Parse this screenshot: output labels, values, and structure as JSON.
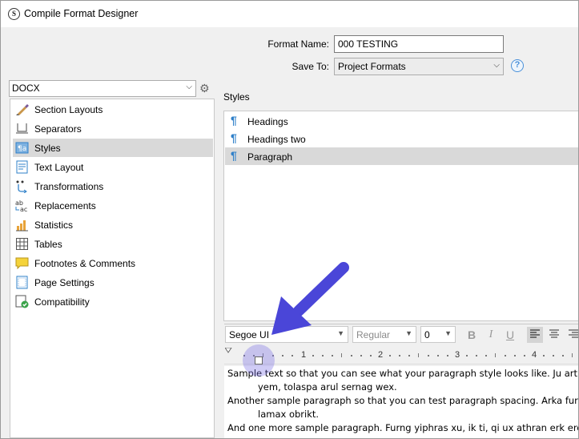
{
  "window": {
    "title": "Compile Format Designer"
  },
  "format": {
    "name_label": "Format Name:",
    "name_value": "000 TESTING",
    "save_label": "Save To:",
    "save_value": "Project Formats",
    "help": "?"
  },
  "sidebar": {
    "format_type": "DOCX",
    "items": [
      {
        "label": "Section Layouts",
        "icon": "section-layouts-icon"
      },
      {
        "label": "Separators",
        "icon": "separators-icon"
      },
      {
        "label": "Styles",
        "icon": "styles-icon",
        "selected": true
      },
      {
        "label": "Text Layout",
        "icon": "text-layout-icon"
      },
      {
        "label": "Transformations",
        "icon": "transformations-icon"
      },
      {
        "label": "Replacements",
        "icon": "replacements-icon"
      },
      {
        "label": "Statistics",
        "icon": "statistics-icon"
      },
      {
        "label": "Tables",
        "icon": "tables-icon"
      },
      {
        "label": "Footnotes & Comments",
        "icon": "footnotes-icon"
      },
      {
        "label": "Page Settings",
        "icon": "page-settings-icon"
      },
      {
        "label": "Compatibility",
        "icon": "compatibility-icon"
      }
    ]
  },
  "styles": {
    "label": "Styles",
    "items": [
      {
        "name": "Headings"
      },
      {
        "name": "Headings two"
      },
      {
        "name": "Paragraph",
        "selected": true
      }
    ]
  },
  "toolbar": {
    "font": "Segoe UI",
    "weight": "Regular",
    "size": "0",
    "bold": "B",
    "italic": "I",
    "underline": "U"
  },
  "ruler": {
    "marks": [
      "1",
      "2",
      "3",
      "4"
    ]
  },
  "preview": {
    "lines": [
      "Sample text so that you can see what your paragraph style looks like. Ju arthran mo",
      "yem, tolaspa arul sernag wex.",
      "Another sample paragraph so that you can test paragraph spacing. Arka furng su ha",
      "lamax obrikt.",
      "And one more sample paragraph. Furng yiphras xu, ik ti, qi ux athran erk erc fli harl"
    ]
  },
  "colors": {
    "accent": "#2f80c9",
    "annotation_arrow": "#4a46d8",
    "highlight": "#786ee6"
  }
}
